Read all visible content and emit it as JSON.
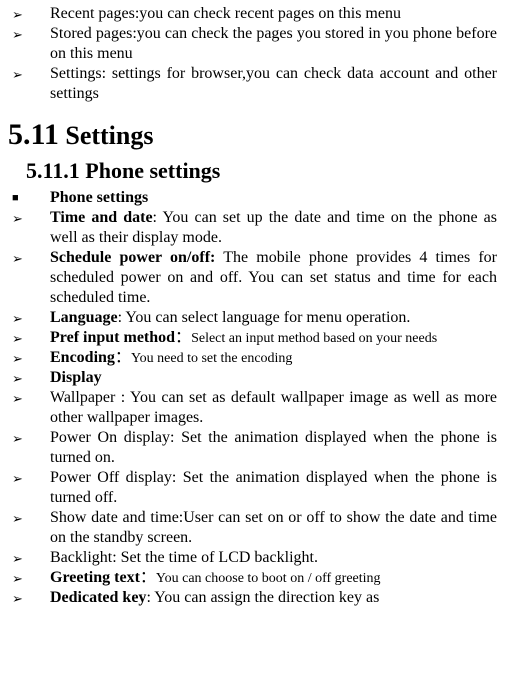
{
  "top": {
    "menu_tail": "menu",
    "recent": "Recent pages:you can check recent pages on this menu",
    "stored": "Stored pages:you can check the pages you stored in you phone before on this menu",
    "settings": "Settings: settings for browser,you can check data account and other settings"
  },
  "sec": {
    "num": "5.11",
    "title": " Settings",
    "sub_num": "5.11.1",
    "sub_title": "  Phone settings"
  },
  "phone_settings_label": "Phone settings",
  "items": {
    "time_date_b": "Time and date",
    "time_date_t": ": You can set up the date and time on the phone as well as their display mode.",
    "sched_b": "Schedule power on/off:",
    "sched_t": " The mobile phone provides 4 times for scheduled power on and off. You can set status and time for each scheduled time.",
    "lang_b": "Language",
    "lang_t": ": You can select language for menu operation.",
    "pref_b": "Pref input method",
    "pref_colon": "：",
    "pref_t": "Select an input method based on your needs",
    "enc_b": "Encoding",
    "enc_colon": "：",
    "enc_t": "You need to set the encoding",
    "display_b": "Display",
    "wallpaper": "Wallpaper : You can set as default wallpaper image as well as more other wallpaper images.",
    "pon": "Power On display: Set the animation displayed when the phone is turned on.",
    "poff": "Power Off display: Set the animation displayed when the phone is turned off.",
    "showdt": "Show date and time:User can set on or off to show the date and time on the standby screen.",
    "backlight": "Backlight: Set the time of LCD backlight.",
    "greet_b": "Greeting text",
    "greet_colon": "：",
    "greet_t": "You can choose to boot on / off greeting",
    "ded_b": "Dedicated key",
    "ded_t": ": You can assign the direction key as"
  }
}
